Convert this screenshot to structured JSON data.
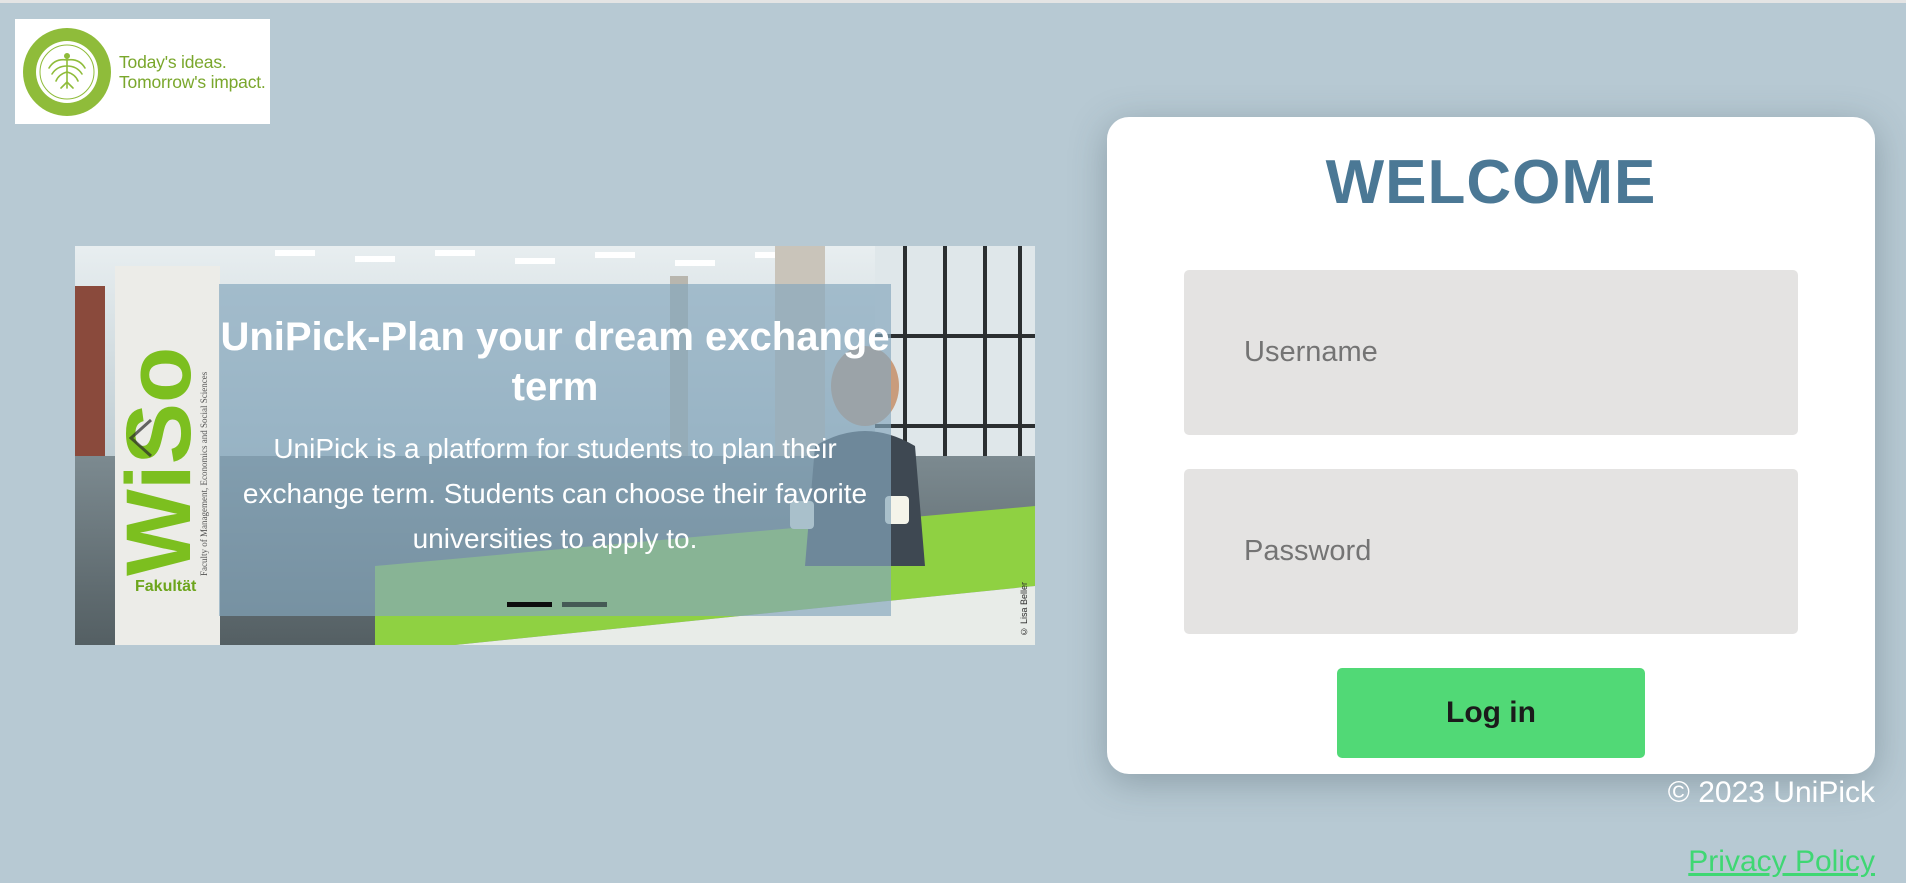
{
  "logo": {
    "line1": "Today's ideas.",
    "line2": "Tomorrow's impact.",
    "brand_color": "#7aa72c"
  },
  "carousel": {
    "title": "UniPick-Plan your dream exchange term",
    "description": "UniPick is a platform for students to plan their exchange term. Students can choose their favorite universities to apply to.",
    "slide_count": 2,
    "active_slide": 1,
    "prev_icon": "chevron-left-icon",
    "photo": {
      "sign_text": "WiSo",
      "sign_subtext": "Fakultät",
      "sign_caption": "Faculty of Management, Economics and Social Sciences",
      "credit": "© Lisa Beller"
    }
  },
  "login": {
    "title": "WELCOME",
    "username_placeholder": "Username",
    "password_placeholder": "Password",
    "button_label": "Log in",
    "title_color": "#4b7895",
    "button_color": "#51d976"
  },
  "footer": {
    "copyright": "© 2023 UniPick",
    "privacy_link": "Privacy Policy",
    "link_color": "#3fd773"
  },
  "theme": {
    "background": "#b7c9d3"
  }
}
